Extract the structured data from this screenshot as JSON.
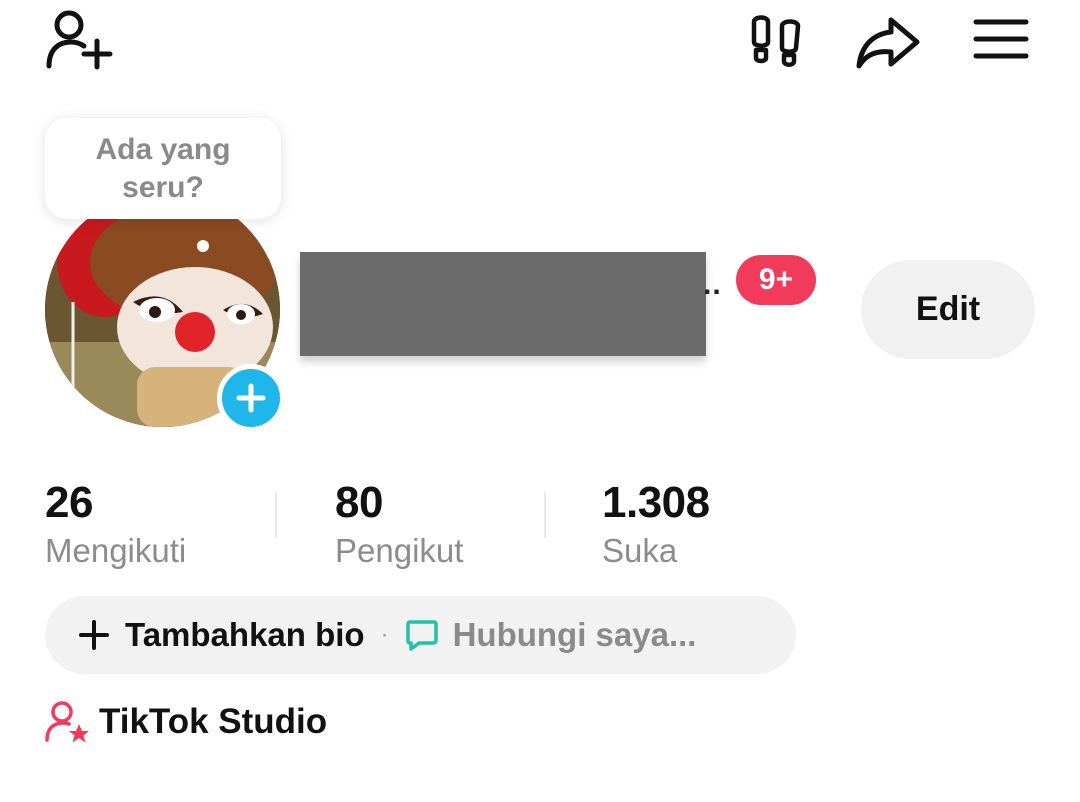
{
  "tooltip": {
    "text": "Ada yang seru?"
  },
  "profile": {
    "name_suffix": "..",
    "notification_badge": "9+",
    "edit_label": "Edit"
  },
  "stats": [
    {
      "value": "26",
      "label": "Mengikuti"
    },
    {
      "value": "80",
      "label": "Pengikut"
    },
    {
      "value": "1.308",
      "label": "Suka"
    }
  ],
  "bio": {
    "add_label": "Tambahkan bio",
    "separator": "·",
    "contact_label": "Hubungi saya..."
  },
  "studio": {
    "label": "TikTok Studio"
  },
  "icons": {
    "add_friend": "add-friend-icon",
    "footprints": "footprints-icon",
    "share": "share-icon",
    "menu": "menu-icon",
    "avatar_add": "plus-icon",
    "bio_add": "plus-icon",
    "contact": "chat-bubble-icon",
    "studio": "creator-star-icon"
  },
  "colors": {
    "badge": "#f23a5b",
    "avatar_add": "#1fb6ea",
    "contact_icon": "#20c3a8",
    "studio_icon": "#f23a5b"
  }
}
